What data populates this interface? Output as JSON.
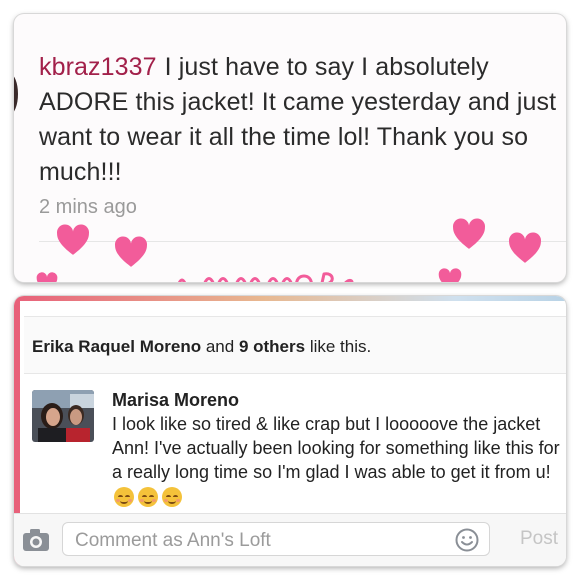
{
  "top_card": {
    "username": "kbraz1337",
    "comment": "I just have to say I absolutely ADORE this jacket! It came yesterday and just want to wear it all the time lol! Thank you so much!!!",
    "time": "2 mins ago",
    "heart_color": "#f25c9a"
  },
  "bottom_card": {
    "likes": {
      "name": "Erika Raquel Moreno",
      "and": "and",
      "others": "9 others",
      "suffix": "like this."
    },
    "comment": {
      "author": "Marisa Moreno",
      "text": "I look like so tired & like crap but I looooove the jacket Ann! I've actually been looking for something like this for a really long time so I'm glad I was able to get it from u!",
      "emoji": "smiling-face-emoji"
    },
    "composer": {
      "placeholder": "Comment as Ann's Loft",
      "post_label": "Post"
    },
    "accent_color": "#e8617a"
  }
}
